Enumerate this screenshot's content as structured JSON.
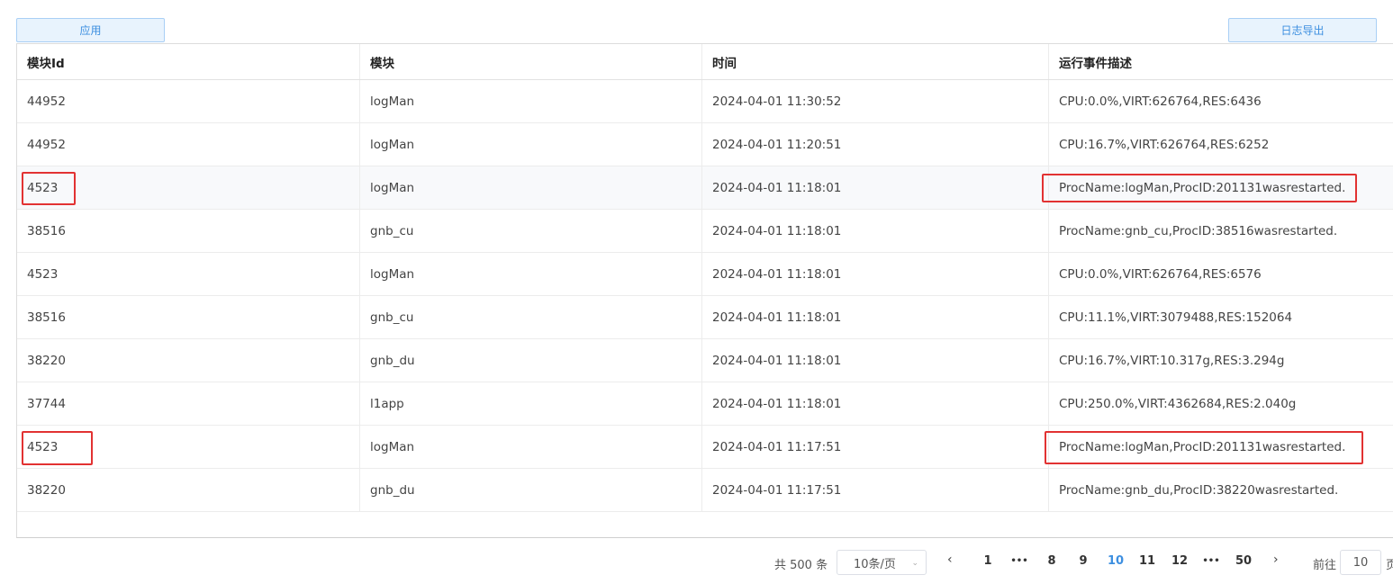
{
  "toolbar": {
    "apply_label": "应用",
    "export_label": "日志导出"
  },
  "table": {
    "headers": [
      "模块Id",
      "模块",
      "时间",
      "运行事件描述"
    ],
    "rows": [
      [
        "44952",
        "logMan",
        "2024-04-01 11:30:52",
        "CPU:0.0%,VIRT:626764,RES:6436"
      ],
      [
        "44952",
        "logMan",
        "2024-04-01 11:20:51",
        "CPU:16.7%,VIRT:626764,RES:6252"
      ],
      [
        "4523",
        "logMan",
        "2024-04-01 11:18:01",
        "ProcName:logMan,ProcID:201131wasrestarted."
      ],
      [
        "38516",
        "gnb_cu",
        "2024-04-01 11:18:01",
        "ProcName:gnb_cu,ProcID:38516wasrestarted."
      ],
      [
        "4523",
        "logMan",
        "2024-04-01 11:18:01",
        "CPU:0.0%,VIRT:626764,RES:6576"
      ],
      [
        "38516",
        "gnb_cu",
        "2024-04-01 11:18:01",
        "CPU:11.1%,VIRT:3079488,RES:152064"
      ],
      [
        "38220",
        "gnb_du",
        "2024-04-01 11:18:01",
        "CPU:16.7%,VIRT:10.317g,RES:3.294g"
      ],
      [
        "37744",
        "l1app",
        "2024-04-01 11:18:01",
        "CPU:250.0%,VIRT:4362684,RES:2.040g"
      ],
      [
        "4523",
        "logMan",
        "2024-04-01 11:17:51",
        "ProcName:logMan,ProcID:201131wasrestarted."
      ],
      [
        "38220",
        "gnb_du",
        "2024-04-01 11:17:51",
        "ProcName:gnb_du,ProcID:38220wasrestarted."
      ]
    ]
  },
  "pagination": {
    "total": "共 500 条",
    "page_size": "10条/页",
    "pages": [
      "1",
      "•••",
      "8",
      "9",
      "10",
      "11",
      "12",
      "•••",
      "50"
    ],
    "current": "10",
    "goto_label": "前往",
    "goto_value": "10",
    "goto_suffix": "页"
  },
  "colors": {
    "accent": "#3d8fe0",
    "highlight": "#e23232"
  }
}
